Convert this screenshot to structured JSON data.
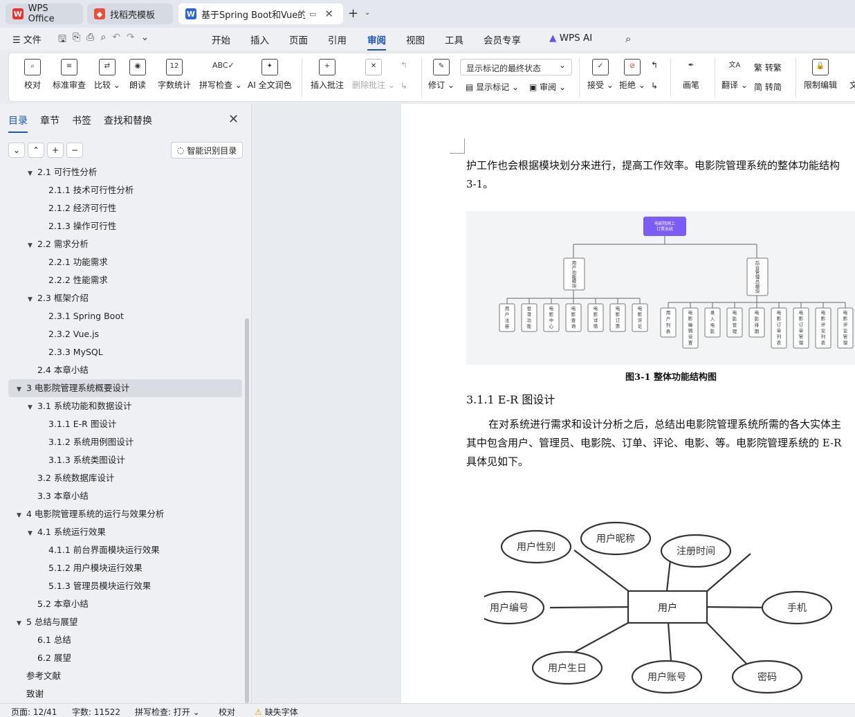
{
  "tabs": [
    {
      "label": "WPS Office",
      "icon": "wps-logo"
    },
    {
      "label": "找稻壳模板",
      "icon": "docer-logo"
    },
    {
      "label": "基于Spring Boot和Vue的前后",
      "icon": "word-doc-icon"
    }
  ],
  "menu": {
    "file": "文件",
    "items": [
      "开始",
      "插入",
      "页面",
      "引用",
      "审阅",
      "视图",
      "工具",
      "会员专享",
      "WPS AI"
    ],
    "active": "审阅"
  },
  "ribbon": {
    "proofread": "校对",
    "std_review": "标准审查",
    "compare": "比较",
    "read_aloud": "朗读",
    "word_count": "字数统计",
    "spell_check": "拼写检查",
    "ai_polish": "AI 全文润色",
    "insert_comment": "插入批注",
    "delete_comment": "删除批注",
    "revise": "修订",
    "markup_select": "显示标记的最终状态",
    "show_markup": "显示标记",
    "review": "审阅",
    "accept": "接受",
    "reject": "拒绝",
    "pen": "画笔",
    "translate": "翻译",
    "to_traditional": "转繁",
    "to_simplified": "转简",
    "restrict_edit": "限制编辑",
    "doc_cut": "文"
  },
  "nav": {
    "tabs": [
      "目录",
      "章节",
      "书签",
      "查找和替换"
    ],
    "smart_toc": "智能识别目录",
    "toc": [
      {
        "label": "2.1  可行性分析",
        "level": 1,
        "caret": true
      },
      {
        "label": "2.1.1  技术可行性分析",
        "level": 2
      },
      {
        "label": "2.1.2  经济可行性",
        "level": 2
      },
      {
        "label": "2.1.3  操作可行性",
        "level": 2
      },
      {
        "label": "2.2  需求分析",
        "level": 1,
        "caret": true
      },
      {
        "label": "2.2.1  功能需求",
        "level": 2
      },
      {
        "label": "2.2.2  性能需求",
        "level": 2
      },
      {
        "label": "2.3  框架介绍",
        "level": 1,
        "caret": true
      },
      {
        "label": "2.3.1 Spring Boot",
        "level": 2
      },
      {
        "label": "2.3.2 Vue.js",
        "level": 2
      },
      {
        "label": "2.3.3 MySQL",
        "level": 2
      },
      {
        "label": "2.4  本章小结",
        "level": 1
      },
      {
        "label": "3  电影院管理系统概要设计",
        "level": 0,
        "caret": true,
        "selected": true
      },
      {
        "label": "3.1  系统功能和数据设计",
        "level": 1,
        "caret": true
      },
      {
        "label": "3.1.1 E-R 图设计",
        "level": 2
      },
      {
        "label": "3.1.2  系统用例图设计",
        "level": 2
      },
      {
        "label": "3.1.3  系统类图设计",
        "level": 2
      },
      {
        "label": "3.2  系统数据库设计",
        "level": 1
      },
      {
        "label": "3.3  本章小结",
        "level": 1
      },
      {
        "label": "4  电影院管理系统的运行与效果分析",
        "level": 0,
        "caret": true
      },
      {
        "label": "4.1  系统运行效果",
        "level": 1,
        "caret": true
      },
      {
        "label": "4.1.1  前台界面模块运行效果",
        "level": 2
      },
      {
        "label": "5.1.2  用户模块运行效果",
        "level": 2
      },
      {
        "label": "5.1.3  管理员模块运行效果",
        "level": 2
      },
      {
        "label": "5.2  本章小结",
        "level": 1
      },
      {
        "label": "5  总结与展望",
        "level": 0,
        "caret": true
      },
      {
        "label": "6.1  总结",
        "level": 1
      },
      {
        "label": "6.2  展望",
        "level": 1
      },
      {
        "label": "参考文献",
        "level": 0
      },
      {
        "label": "致谢",
        "level": 0
      }
    ]
  },
  "doc": {
    "para1_line1": "护工作也会根据模块划分来进行，提高工作效率。电影院管理系统的整体功能结构",
    "para1_line2": "3-1。",
    "figure": {
      "root": "电影院网上订票系统",
      "left_module": "用户功能模块",
      "right_module": "后台管理员模块",
      "left_children": [
        "用户注册",
        "登录功能",
        "电影中心",
        "电影查询",
        "电影详情",
        "电影订票",
        "电影评论"
      ],
      "right_children": [
        "用户列表",
        "电影编辑设置",
        "录入电影",
        "电影管理",
        "电影排期",
        "电影订单列表",
        "电影订单管理",
        "电影评论列表",
        "电影评论管理"
      ]
    },
    "caption": "图3-1  整体功能结构图",
    "heading": "3.1.1 E-R 图设计",
    "para2_line1": "在对系统进行需求和设计分析之后，总结出电影院管理系统所需的各大实体主",
    "para2_line2": "其中包含用户、管理员、电影院、订单、评论、电影、等。电影院管理系统的 E-R",
    "para2_line3": "具体见如下。",
    "er": {
      "entity": "用户",
      "attributes": [
        "用户性别",
        "用户昵称",
        "注册时间",
        "用户编号",
        "手机",
        "用户生日",
        "用户账号",
        "密码"
      ]
    }
  },
  "status": {
    "page": "页面: 12/41",
    "words": "字数: 11522",
    "spell": "拼写检查: 打开",
    "proof": "校对",
    "missing_font": "缺失字体"
  }
}
